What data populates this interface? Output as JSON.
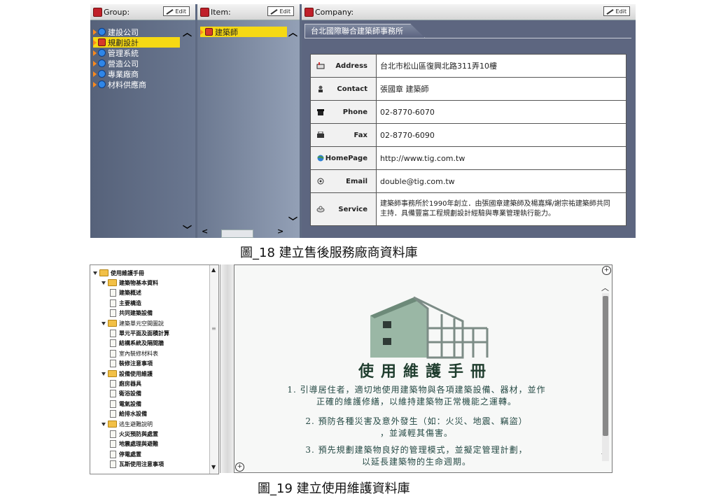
{
  "fig18": {
    "group_pane": {
      "title": "Group:",
      "edit_label": "Edit",
      "items": [
        {
          "label": "建設公司",
          "selected": false
        },
        {
          "label": "規劃設計",
          "selected": true
        },
        {
          "label": "管理系統",
          "selected": false
        },
        {
          "label": "營造公司",
          "selected": false
        },
        {
          "label": "專業廠商",
          "selected": false
        },
        {
          "label": "材料供應商",
          "selected": false
        }
      ]
    },
    "item_pane": {
      "title": "Item:",
      "edit_label": "Edit",
      "items": [
        {
          "label": "建築師",
          "selected": true
        }
      ]
    },
    "company_pane": {
      "title": "Company:",
      "edit_label": "Edit",
      "tab_label": "台北國際聯合建築師事務所",
      "rows": [
        {
          "icon": "mailbox-icon",
          "label": "Address",
          "value": "台北市松山區復興北路311弄10樓"
        },
        {
          "icon": "person-icon",
          "label": "Contact",
          "value": "張國章 建築師"
        },
        {
          "icon": "phone-icon",
          "label": "Phone",
          "value": "02-8770-6070"
        },
        {
          "icon": "fax-icon",
          "label": "Fax",
          "value": "02-8770-6090"
        },
        {
          "icon": "globe-icon",
          "label": "HomePage",
          "value": "http://www.tig.com.tw"
        },
        {
          "icon": "email-icon",
          "label": "Email",
          "value": "double@tig.com.tw"
        },
        {
          "icon": "service-icon",
          "label": "Service",
          "value_line1": "建築師事務所於1990年創立．由張國章建築師及楊嘉輝/謝宗祐建築師共同",
          "value_line2": "主持．具備豐富工程規劃設計經驗與專業管理執行能力。"
        }
      ]
    },
    "caption": "圖_18  建立售後服務廠商資料庫"
  },
  "fig19": {
    "toc": [
      {
        "level": 0,
        "type": "folder",
        "label": "使用維護手冊",
        "bold": true
      },
      {
        "level": 1,
        "type": "folder",
        "label": "建築物基本資料",
        "bold": true
      },
      {
        "level": 2,
        "type": "page",
        "label": "建築概述",
        "bold": true
      },
      {
        "level": 2,
        "type": "page",
        "label": "主要構造",
        "bold": true
      },
      {
        "level": 2,
        "type": "page",
        "label": "共同建築設備",
        "bold": true
      },
      {
        "level": 1,
        "type": "folder",
        "label": "建築單元空間圖說",
        "bold": false
      },
      {
        "level": 2,
        "type": "page",
        "label": "單元平面及面積計算",
        "bold": true
      },
      {
        "level": 2,
        "type": "page",
        "label": "結構系統及隔間牆",
        "bold": true
      },
      {
        "level": 2,
        "type": "page",
        "label": "室內裝修材料表",
        "bold": false
      },
      {
        "level": 2,
        "type": "page",
        "label": "裝修注意事項",
        "bold": true
      },
      {
        "level": 1,
        "type": "folder",
        "label": "設備使用維護",
        "bold": true
      },
      {
        "level": 2,
        "type": "page",
        "label": "廚房器具",
        "bold": true
      },
      {
        "level": 2,
        "type": "page",
        "label": "衛浴設備",
        "bold": true
      },
      {
        "level": 2,
        "type": "page",
        "label": "電氣設備",
        "bold": true
      },
      {
        "level": 2,
        "type": "page",
        "label": "給排水設備",
        "bold": true
      },
      {
        "level": 1,
        "type": "folder",
        "label": "逃生避難說明",
        "bold": false
      },
      {
        "level": 2,
        "type": "page",
        "label": "火災預防與處置",
        "bold": true
      },
      {
        "level": 2,
        "type": "page",
        "label": "地震處理與避難",
        "bold": true
      },
      {
        "level": 2,
        "type": "page",
        "label": "停電處置",
        "bold": true
      },
      {
        "level": 2,
        "type": "page",
        "label": "瓦斯使用注意事項",
        "bold": true
      }
    ],
    "manual_title": "使用維護手冊",
    "paragraphs": [
      {
        "line1": "1. 引導居住者，適切地使用建築物與各項建築設備、器材，並作",
        "line2": "正確的維護修繕，以維持建築物正常機能之運轉。"
      },
      {
        "line1": "2. 預防各種災害及意外發生（如：火災、地震、竊盜）",
        "line2": "，並減輕其傷害。"
      },
      {
        "line1": "3. 預先規劃建築物良好的管理模式，並擬定管理計劃，",
        "line2": "以延長建築物的生命週期。"
      }
    ],
    "caption": "圖_19  建立使用維護資料庫"
  },
  "colors": {
    "pane_bg": "#5e6a82",
    "selection": "#f6d913",
    "node_arrow": "#ff8a1c",
    "node_dot": "#2f86e8",
    "manual_text": "#264a45"
  }
}
